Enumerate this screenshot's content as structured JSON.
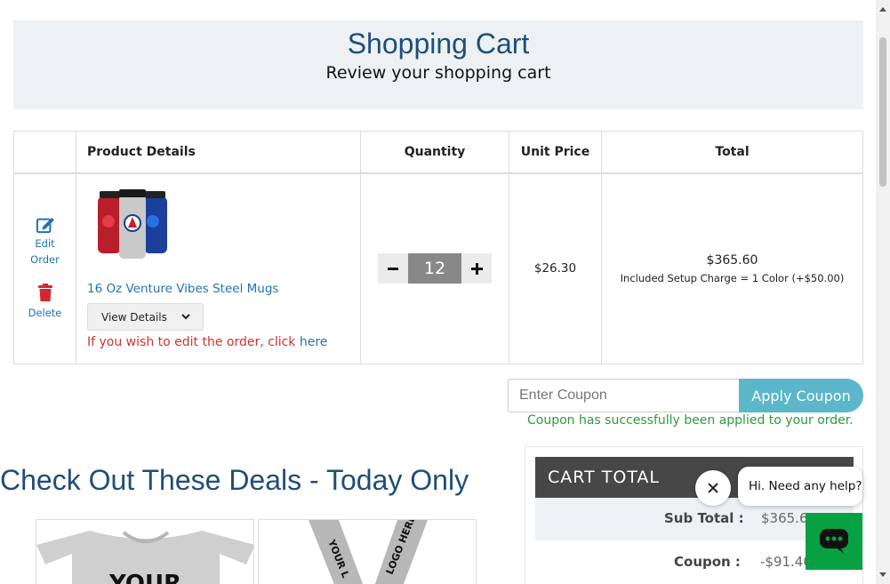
{
  "header": {
    "title": "Shopping Cart",
    "subtitle": "Review your shopping cart"
  },
  "table": {
    "columns": [
      "",
      "Product Details",
      "Quantity",
      "Unit Price",
      "Total"
    ],
    "rows": [
      {
        "edit_label": "Edit Order",
        "delete_label": "Delete",
        "product_name": "16 Oz Venture Vibes Steel Mugs",
        "view_details_label": "View Details",
        "edit_note": "If you wish to edit the order, click ",
        "edit_link": "here",
        "quantity": "12",
        "unit_price": "$26.30",
        "total": "$365.60",
        "total_note": "Included Setup Charge = 1 Color (+$50.00)"
      }
    ]
  },
  "coupon": {
    "placeholder": "Enter Coupon",
    "apply_label": "Apply Coupon",
    "success_message": "Coupon has successfully been applied to your order."
  },
  "deals": {
    "title": "Check Out These Deals - Today Only"
  },
  "cart_total": {
    "header": "CART  TOTAL",
    "sub_total_label": "Sub Total :",
    "sub_total_value": "$365.60",
    "coupon_label": "Coupon :",
    "coupon_value": "-$91.40"
  },
  "chat": {
    "greeting": "Hi. Need any help?"
  },
  "colors": {
    "accent_blue": "#1f4e79",
    "link_blue": "#1f73b7",
    "coupon_button": "#5bb7c9",
    "success_green": "#2e9a3e",
    "chat_green": "#07a143",
    "error_red": "#d0342c"
  }
}
